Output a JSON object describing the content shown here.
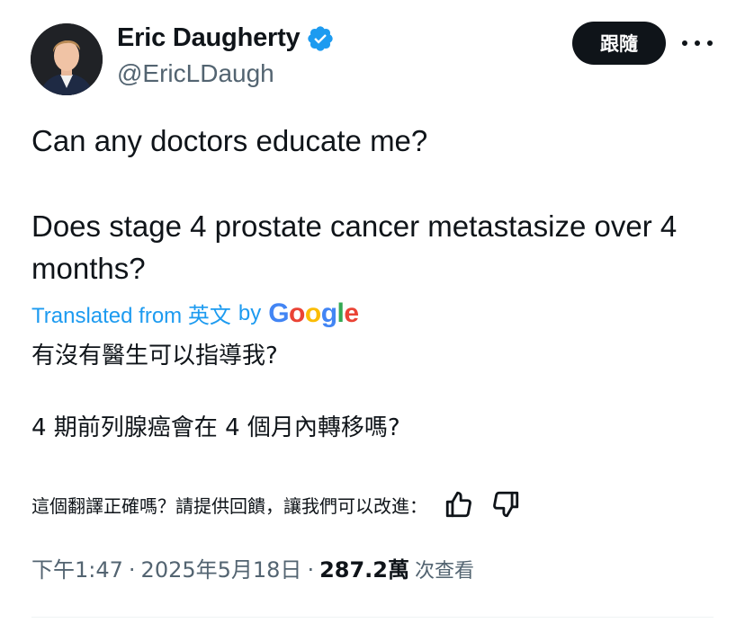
{
  "author": {
    "display_name": "Eric Daugherty",
    "handle": "@EricLDaugh",
    "verified": true
  },
  "header": {
    "follow_label": "跟隨",
    "more_icon": "more-horizontal-icon"
  },
  "tweet": {
    "line1": "Can any doctors educate me?",
    "line2": "Does stage 4 prostate cancer metastasize over 4 months?"
  },
  "translation": {
    "translated_from": "Translated from 英文",
    "by": "by",
    "google": [
      "G",
      "o",
      "o",
      "g",
      "l",
      "e"
    ],
    "line1": "有沒有醫生可以指導我?",
    "line2": "4 期前列腺癌會在 4 個月內轉移嗎?"
  },
  "feedback": {
    "prompt": "這個翻譯正確嗎？請提供回饋，讓我們可以改進：",
    "thumbs_up_icon": "thumbs-up-icon",
    "thumbs_down_icon": "thumbs-down-icon"
  },
  "meta": {
    "time": "下午1:47",
    "separator": "·",
    "date": "2025年5月18日",
    "views_count": "287.2萬",
    "views_label": "次查看"
  },
  "colors": {
    "accent": "#1d9bf0",
    "text": "#0f1419",
    "secondary": "#536471",
    "button_bg": "#0f1419"
  }
}
